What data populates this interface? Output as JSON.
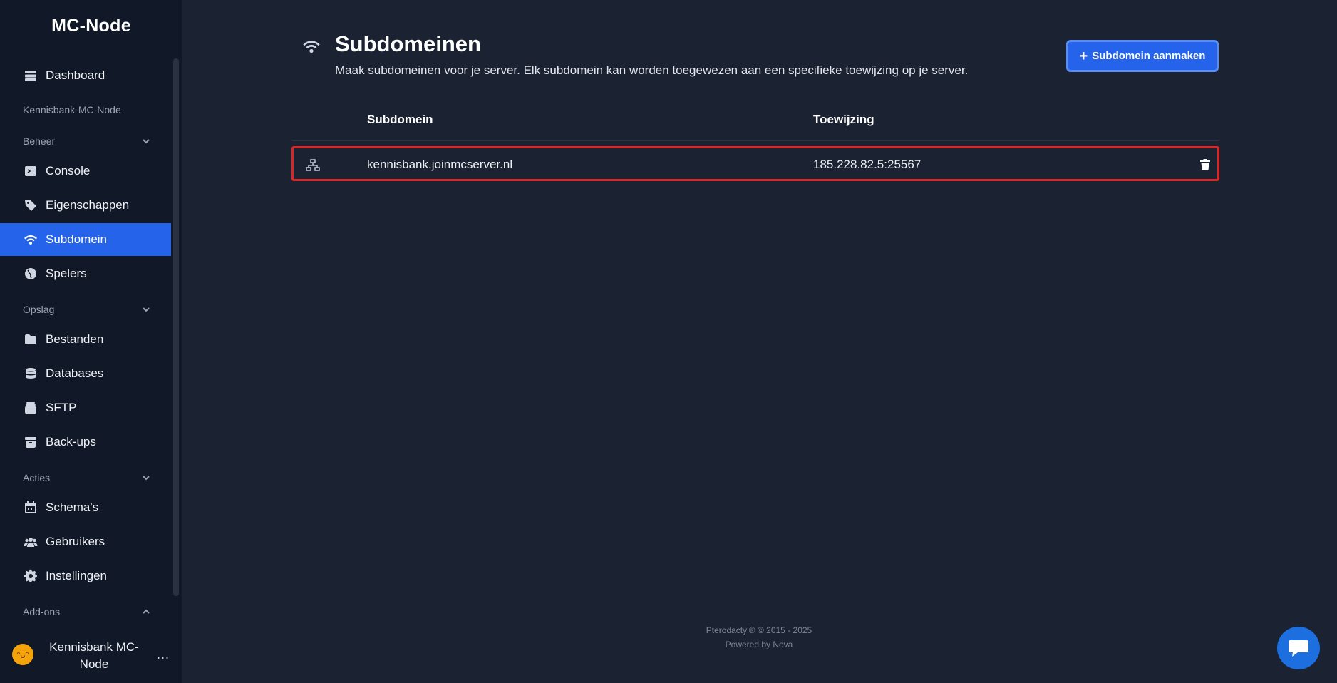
{
  "sidebar": {
    "brand": "MC-Node",
    "dashboard": "Dashboard",
    "server_name": "Kennisbank-MC-Node",
    "sections": {
      "beheer": "Beheer",
      "opslag": "Opslag",
      "acties": "Acties",
      "addons": "Add-ons"
    },
    "items": {
      "console": "Console",
      "eigenschappen": "Eigenschappen",
      "subdomein": "Subdomein",
      "spelers": "Spelers",
      "bestanden": "Bestanden",
      "databases": "Databases",
      "sftp": "SFTP",
      "backups": "Back-ups",
      "schemas": "Schema's",
      "gebruikers": "Gebruikers",
      "instellingen": "Instellingen"
    },
    "active_item": "Subdomein",
    "user": {
      "name": "Kennisbank MC-Node",
      "more": "..."
    }
  },
  "main": {
    "title": "Subdomeinen",
    "description": "Maak subdomeinen voor je server. Elk subdomein kan worden toegewezen aan een specifieke toewijzing op je server.",
    "create_button": "Subdomein aanmaken",
    "table": {
      "columns": [
        "Subdomein",
        "Toewijzing"
      ],
      "rows": [
        {
          "subdomain": "kennisbank.joinmcserver.nl",
          "allocation": "185.228.82.5:25567"
        }
      ]
    }
  },
  "footer": {
    "copyright": "Pterodactyl® © 2015 - 2025",
    "powered": "Powered by Nova"
  },
  "colors": {
    "accent": "#2563eb",
    "sidebar_bg": "#111827",
    "main_bg": "#1b2232",
    "highlight": "#dc2626"
  }
}
